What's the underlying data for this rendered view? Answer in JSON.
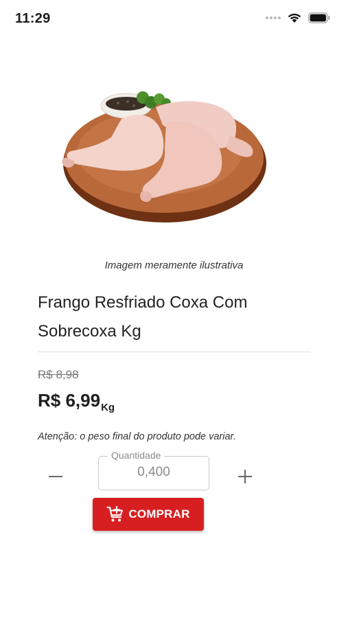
{
  "status_bar": {
    "time": "11:29"
  },
  "product": {
    "image_caption": "Imagem meramente ilustrativa",
    "title": "Frango Resfriado Coxa Com Sobrecoxa Kg",
    "old_price": "R$ 8,98",
    "price": "R$ 6,99",
    "price_unit": "Kg",
    "weight_notice": "Atenção: o peso final do produto pode variar."
  },
  "quantity": {
    "label": "Quantidade",
    "value": "0,400"
  },
  "buy_button": {
    "label": "COMPRAR",
    "icon": "add-to-cart-icon"
  },
  "colors": {
    "accent": "#d71f22"
  }
}
